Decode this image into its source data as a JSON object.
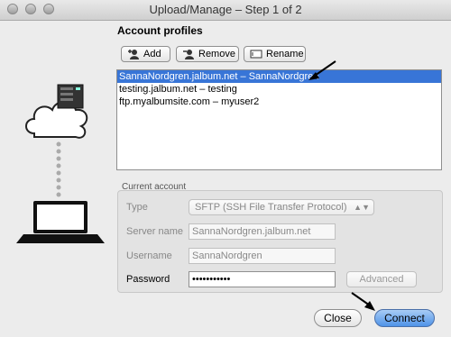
{
  "window": {
    "title": "Upload/Manage – Step 1 of 2"
  },
  "profiles": {
    "heading": "Account profiles",
    "add_label": "Add",
    "remove_label": "Remove",
    "rename_label": "Rename",
    "items": [
      {
        "label": "SannaNordgren.jalbum.net – SannaNordgren",
        "selected": true
      },
      {
        "label": "testing.jalbum.net – testing",
        "selected": false
      },
      {
        "label": "ftp.myalbumsite.com – myuser2",
        "selected": false
      }
    ]
  },
  "account": {
    "heading": "Current account",
    "type_label": "Type",
    "type_value": "SFTP (SSH File Transfer Protocol)",
    "server_label": "Server name",
    "server_value": "SannaNordgren.jalbum.net",
    "username_label": "Username",
    "username_value": "SannaNordgren",
    "password_label": "Password",
    "password_value": "•••••••••••",
    "advanced_label": "Advanced"
  },
  "footer": {
    "close_label": "Close",
    "connect_label": "Connect"
  },
  "colors": {
    "selection": "#3875d7",
    "connect": "#4f93e8"
  }
}
